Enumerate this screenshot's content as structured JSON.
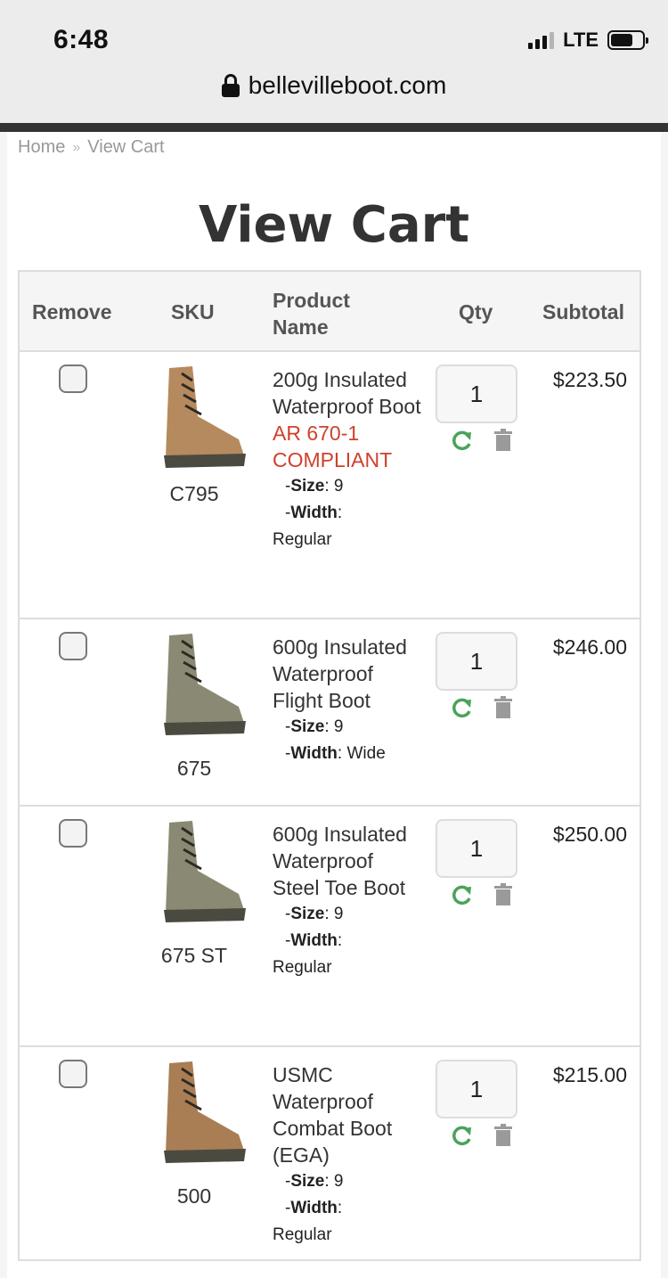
{
  "status_bar": {
    "time": "6:48",
    "network": "LTE"
  },
  "browser": {
    "url": "bellevilleboot.com"
  },
  "breadcrumb": {
    "home": "Home",
    "separator": "»",
    "current": "View Cart"
  },
  "page_title": "View Cart",
  "table": {
    "headers": {
      "remove": "Remove",
      "sku": "SKU",
      "product_name": "Product Name",
      "qty": "Qty",
      "subtotal": "Subtotal"
    },
    "rows": [
      {
        "sku": "C795",
        "name": "200g Insulated Waterproof Boot",
        "notice": "AR 670-1 COMPLIANT",
        "size_label": "Size",
        "size": "9",
        "width_label": "Width",
        "width": "Regular",
        "qty": "1",
        "subtotal": "$223.50",
        "boot_color": "#b58a5e"
      },
      {
        "sku": "675",
        "name": "600g Insulated Waterproof Flight Boot",
        "size_label": "Size",
        "size": "9",
        "width_label": "Width",
        "width": "Wide",
        "qty": "1",
        "subtotal": "$246.00",
        "boot_color": "#8a8a74"
      },
      {
        "sku": "675 ST",
        "name": "600g Insulated Waterproof Steel Toe Boot",
        "size_label": "Size",
        "size": "9",
        "width_label": "Width",
        "width": "Regular",
        "qty": "1",
        "subtotal": "$250.00",
        "boot_color": "#8a8a74"
      },
      {
        "sku": "500",
        "name": "USMC Waterproof Combat Boot (EGA)",
        "size_label": "Size",
        "size": "9",
        "width_label": "Width",
        "width": "Regular",
        "qty": "1",
        "subtotal": "$215.00",
        "boot_color": "#a97e55"
      }
    ]
  },
  "colors": {
    "notice": "#d0402c",
    "refresh": "#4aa35a",
    "trash": "#9a9a9a"
  }
}
